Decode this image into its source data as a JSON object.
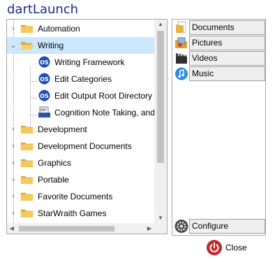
{
  "app": {
    "title": "dartLaunch"
  },
  "tree": {
    "items": [
      {
        "label": "Automation",
        "icon": "folder-icon",
        "expanded": false
      },
      {
        "label": "Writing",
        "icon": "folder-open-icon",
        "expanded": true,
        "selected": true
      },
      {
        "label": "Writing Framework",
        "icon": "app-os-icon"
      },
      {
        "label": "Edit Categories",
        "icon": "app-os-icon"
      },
      {
        "label": "Edit Output Root Directory",
        "icon": "app-os-icon"
      },
      {
        "label": "Cognition Note Taking, and D",
        "icon": "app-cue-icon"
      },
      {
        "label": "Development",
        "icon": "folder-icon",
        "expanded": false
      },
      {
        "label": "Development Documents",
        "icon": "folder-icon",
        "expanded": false
      },
      {
        "label": "Graphics",
        "icon": "folder-icon",
        "expanded": false
      },
      {
        "label": "Portable",
        "icon": "folder-icon",
        "expanded": false
      },
      {
        "label": "Favorite Documents",
        "icon": "folder-icon",
        "expanded": false
      },
      {
        "label": "StarWraith Games",
        "icon": "folder-icon",
        "expanded": false
      }
    ]
  },
  "shortcuts": [
    {
      "label": "Documents",
      "icon": "documents-icon"
    },
    {
      "label": "Pictures",
      "icon": "pictures-icon"
    },
    {
      "label": "Videos",
      "icon": "videos-icon"
    },
    {
      "label": "Music",
      "icon": "music-icon"
    }
  ],
  "configure": {
    "label": "Configure",
    "icon": "gear-icon"
  },
  "close": {
    "label": "Close",
    "icon": "power-icon"
  },
  "colors": {
    "title": "#1f2a8a",
    "selection": "#cce8ff",
    "close": "#c4262e"
  }
}
